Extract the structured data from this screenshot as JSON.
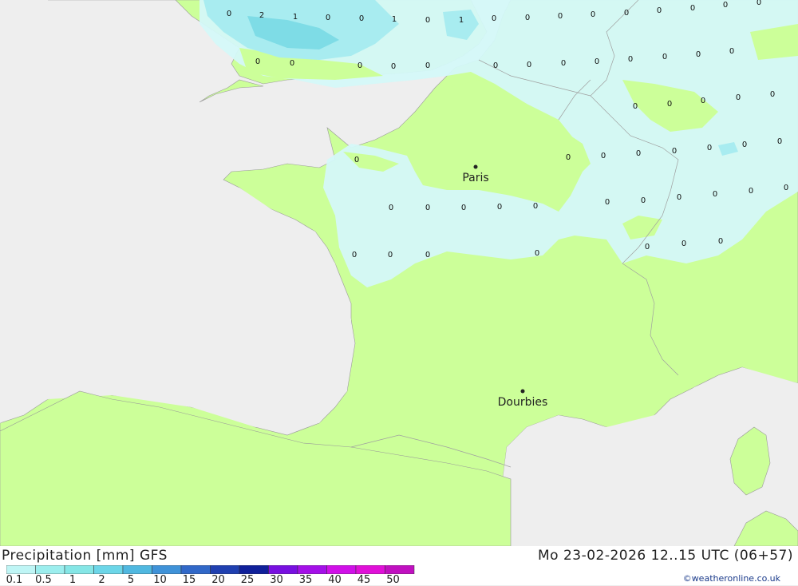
{
  "title": "Precipitation [mm] GFS",
  "datetime": "Mo 23-02-2026 12..15 UTC (06+57)",
  "credit": "©weatheronline.co.uk",
  "cities": [
    {
      "name": "Paris"
    },
    {
      "name": "Dourbies"
    }
  ],
  "legend": {
    "labels": [
      "0.1",
      "0.5",
      "1",
      "2",
      "5",
      "10",
      "15",
      "20",
      "25",
      "30",
      "35",
      "40",
      "45",
      "50"
    ],
    "colors": [
      "#bff5f5",
      "#9ceeee",
      "#85e6e6",
      "#6cd6e8",
      "#50b8e0",
      "#3f92d8",
      "#3168c8",
      "#2040b0",
      "#10209a",
      "#7810e0",
      "#a410e8",
      "#d010e8",
      "#e010d8",
      "#c010c0"
    ]
  },
  "colors": {
    "land": "#ccff99",
    "sea": "#eeeeee",
    "precip_light": "#d4f8f8",
    "precip_medium": "#a8ecf0",
    "precip_heavy": "#7edce6"
  },
  "grid_values": [
    "0",
    "2",
    "1",
    "0",
    "0",
    "1",
    "0",
    "1",
    "0",
    "0",
    "0",
    "0",
    "0",
    "0",
    "0",
    "0",
    "0",
    "0",
    "0",
    "0",
    "0",
    "0",
    "0",
    "0",
    "0",
    "0",
    "0",
    "0",
    "0",
    "0",
    "0",
    "0",
    "0",
    "0",
    "0",
    "0",
    "0",
    "0",
    "0",
    "0",
    "0",
    "0",
    "0",
    "0",
    "0",
    "0",
    "0",
    "0",
    "0",
    "0",
    "0",
    "0",
    "0",
    "0",
    "0",
    "0",
    "0",
    "0",
    "0",
    "0",
    "0",
    "0",
    "0",
    "0",
    "0",
    "0",
    "0",
    "0",
    "0",
    "0",
    "0"
  ]
}
